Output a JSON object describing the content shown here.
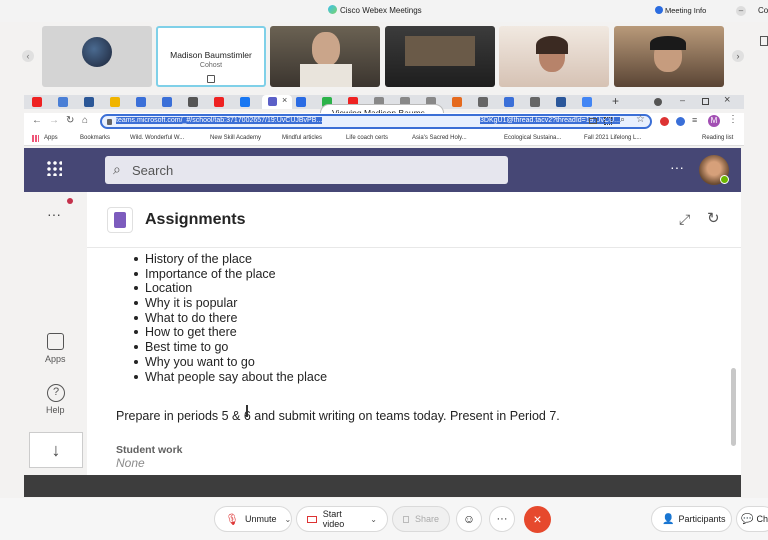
{
  "webex": {
    "title": "Cisco Webex Meetings",
    "meeting_info": "Meeting Info",
    "participant_name": "Madison Baumstimler",
    "participant_role": "Cohost",
    "viewing_label": "Viewing Madison Baums...",
    "controls": {
      "unmute": "Unmute",
      "start_video": "Start video",
      "share": "Share",
      "participants": "Participants",
      "chat": "Ch"
    },
    "right_edge": "Co"
  },
  "browser": {
    "url": "teams.microsoft.com/_#/school/tab:3717002657/19:UvCUJBvPB...",
    "url_tail": "3DKgU1@thread.tacv2?threadId=19:UvCU...",
    "bookmarks": [
      "Apps",
      "Bookmarks",
      "Wild. Wonderful W...",
      "New Skill Academy",
      "Mindful articles",
      "Life coach certs",
      "Asia's Sacred Holy...",
      "Ecological Sustaina...",
      "Fall 2021 Lifelong L..."
    ],
    "reading_list": "Reading list",
    "profile_initial": "M"
  },
  "teams": {
    "search_placeholder": "Search",
    "rail": {
      "apps": "Apps",
      "help": "Help"
    },
    "page_title": "Assignments",
    "bullets": [
      "History of the place",
      "Importance of the place",
      "Location",
      "Why it is popular",
      "What to do there",
      "How to get there",
      "Best time to go",
      "Why you want to go",
      "What people say about the place"
    ],
    "instructions": "Prepare in periods 5 & 6 and submit writing on teams today. Present in Period 7.",
    "student_work_label": "Student work",
    "student_work_value": "None"
  },
  "colors": {
    "teams_purple": "#464775",
    "webex_highlight": "#7fd0e8",
    "leave_red": "#e6492d"
  }
}
